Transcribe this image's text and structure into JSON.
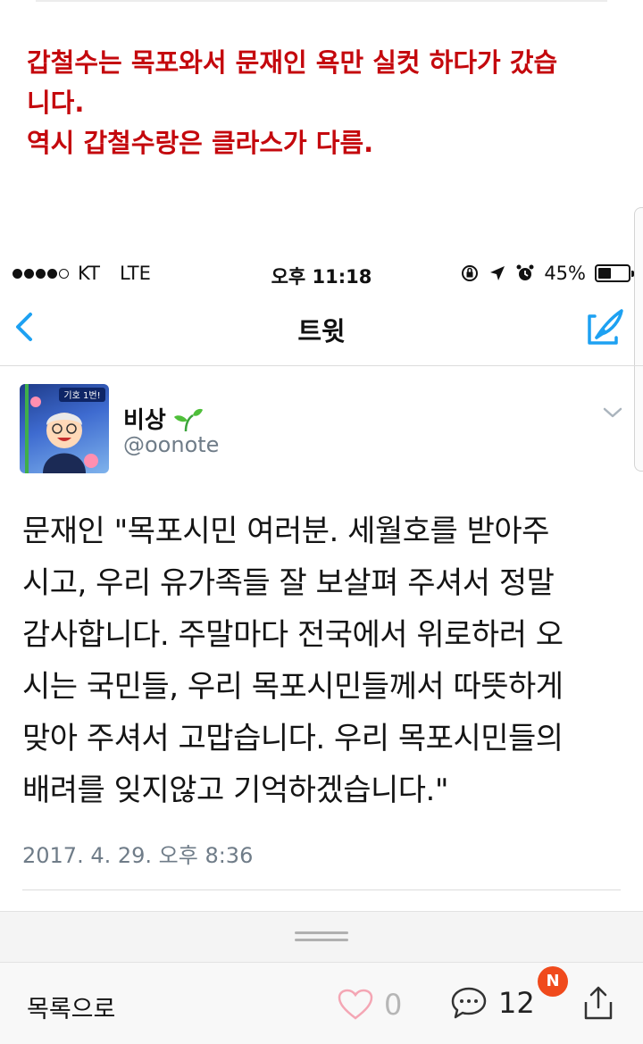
{
  "caption": {
    "line1": "갑철수는 목포와서 문재인 욕만 실컷 하다가 갔습\n니다.",
    "line2": "역시 갑철수랑은 클라스가 다름."
  },
  "statusbar": {
    "carrier": "KT",
    "network": "LTE",
    "time": "오후 11:18",
    "battery": "45%",
    "battery_level": 0.45
  },
  "navbar": {
    "title": "트윗"
  },
  "tweet": {
    "avatar_text": "기호 1번!",
    "name": "비상",
    "handle": "@oonote",
    "body": "문재인 \"목포시민 여러분. 세월호를 받아주\n시고, 우리 유가족들 잘 보살펴 주셔서 정말\n감사합니다. 주말마다 전국에서 위로하러 오\n시는 국민들, 우리 목포시민들께서 따뜻하게\n맞아 주셔서 고맙습니다. 우리 목포시민들의\n배려를 잊지않고 기억하겠습니다.\"",
    "date": "2017. 4. 29. 오후 8:36"
  },
  "bottombar": {
    "back_label": "목록으로",
    "like_count": "0",
    "comment_count": "12",
    "new_badge": "N"
  },
  "colors": {
    "caption_red": "#c4080d",
    "twitter_blue": "#1da1f2",
    "badge_orange": "#f04a1c",
    "meta_gray": "#6f7c88"
  }
}
